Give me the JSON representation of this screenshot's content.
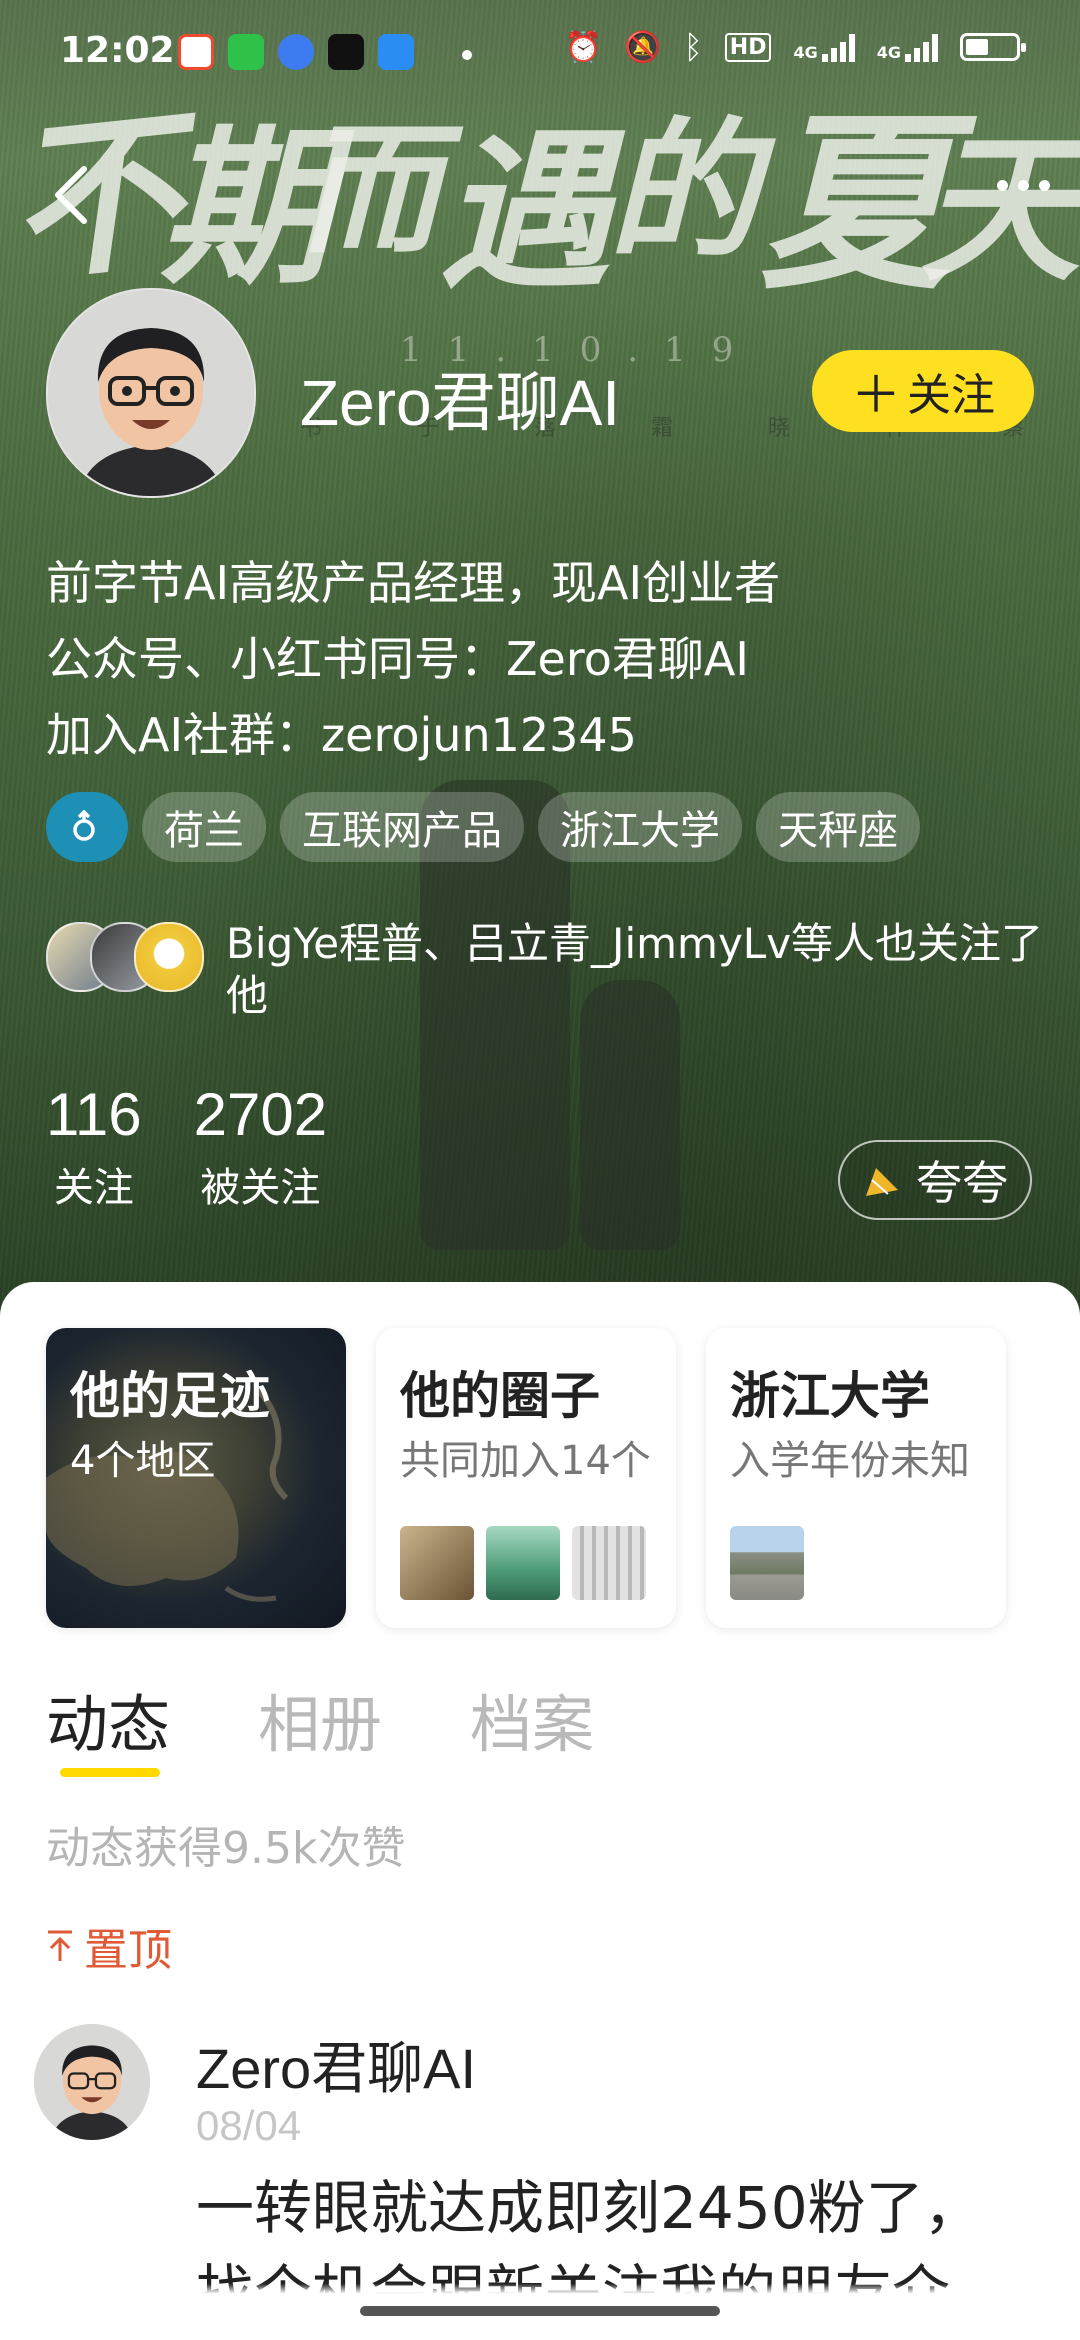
{
  "status_bar": {
    "time": "12:02",
    "network_label": "HD",
    "signal1_label": "4G",
    "signal2_label": "4G"
  },
  "cover": {
    "title_chars": [
      "不",
      "期",
      "而",
      "遇",
      "的",
      "夏",
      "天"
    ],
    "subtitle": "11.10.19",
    "tagline": "书 于 落 霜 晓 什 察"
  },
  "profile": {
    "username": "Zero君聊AI",
    "follow_label": "关注",
    "bio_lines": [
      "前字节AI高级产品经理，现AI创业者",
      "公众号、小红书同号：Zero君聊AI",
      "加入AI社群：zerojun12345"
    ],
    "gender_icon": "male-symbol-icon",
    "tags": [
      "荷兰",
      "互联网产品",
      "浙江大学",
      "天秤座"
    ],
    "mutual_text": "BigYe程普、吕立青_JimmyLv等人也关注了他",
    "following_count": "116",
    "following_label": "关注",
    "followers_count": "2702",
    "followers_label": "被关注",
    "praise_label": "夸夸"
  },
  "cards": [
    {
      "title": "他的足迹",
      "subtitle": "4个地区"
    },
    {
      "title": "他的圈子",
      "subtitle": "共同加入14个"
    },
    {
      "title": "浙江大学",
      "subtitle": "入学年份未知"
    }
  ],
  "tabs": [
    "动态",
    "相册",
    "档案"
  ],
  "feed": {
    "likes_summary": "动态获得9.5k次赞",
    "pinned_label": "置顶",
    "post": {
      "author": "Zero君聊AI",
      "date": "08/04",
      "text_line1": "一转眼就达成即刻2450粉了，",
      "text_line2": "找个机会跟新关注我的朋友介"
    }
  },
  "colors": {
    "accent_yellow": "#ffe021",
    "pinned_red": "#e05a36",
    "gender_blue": "#1e90b5"
  }
}
